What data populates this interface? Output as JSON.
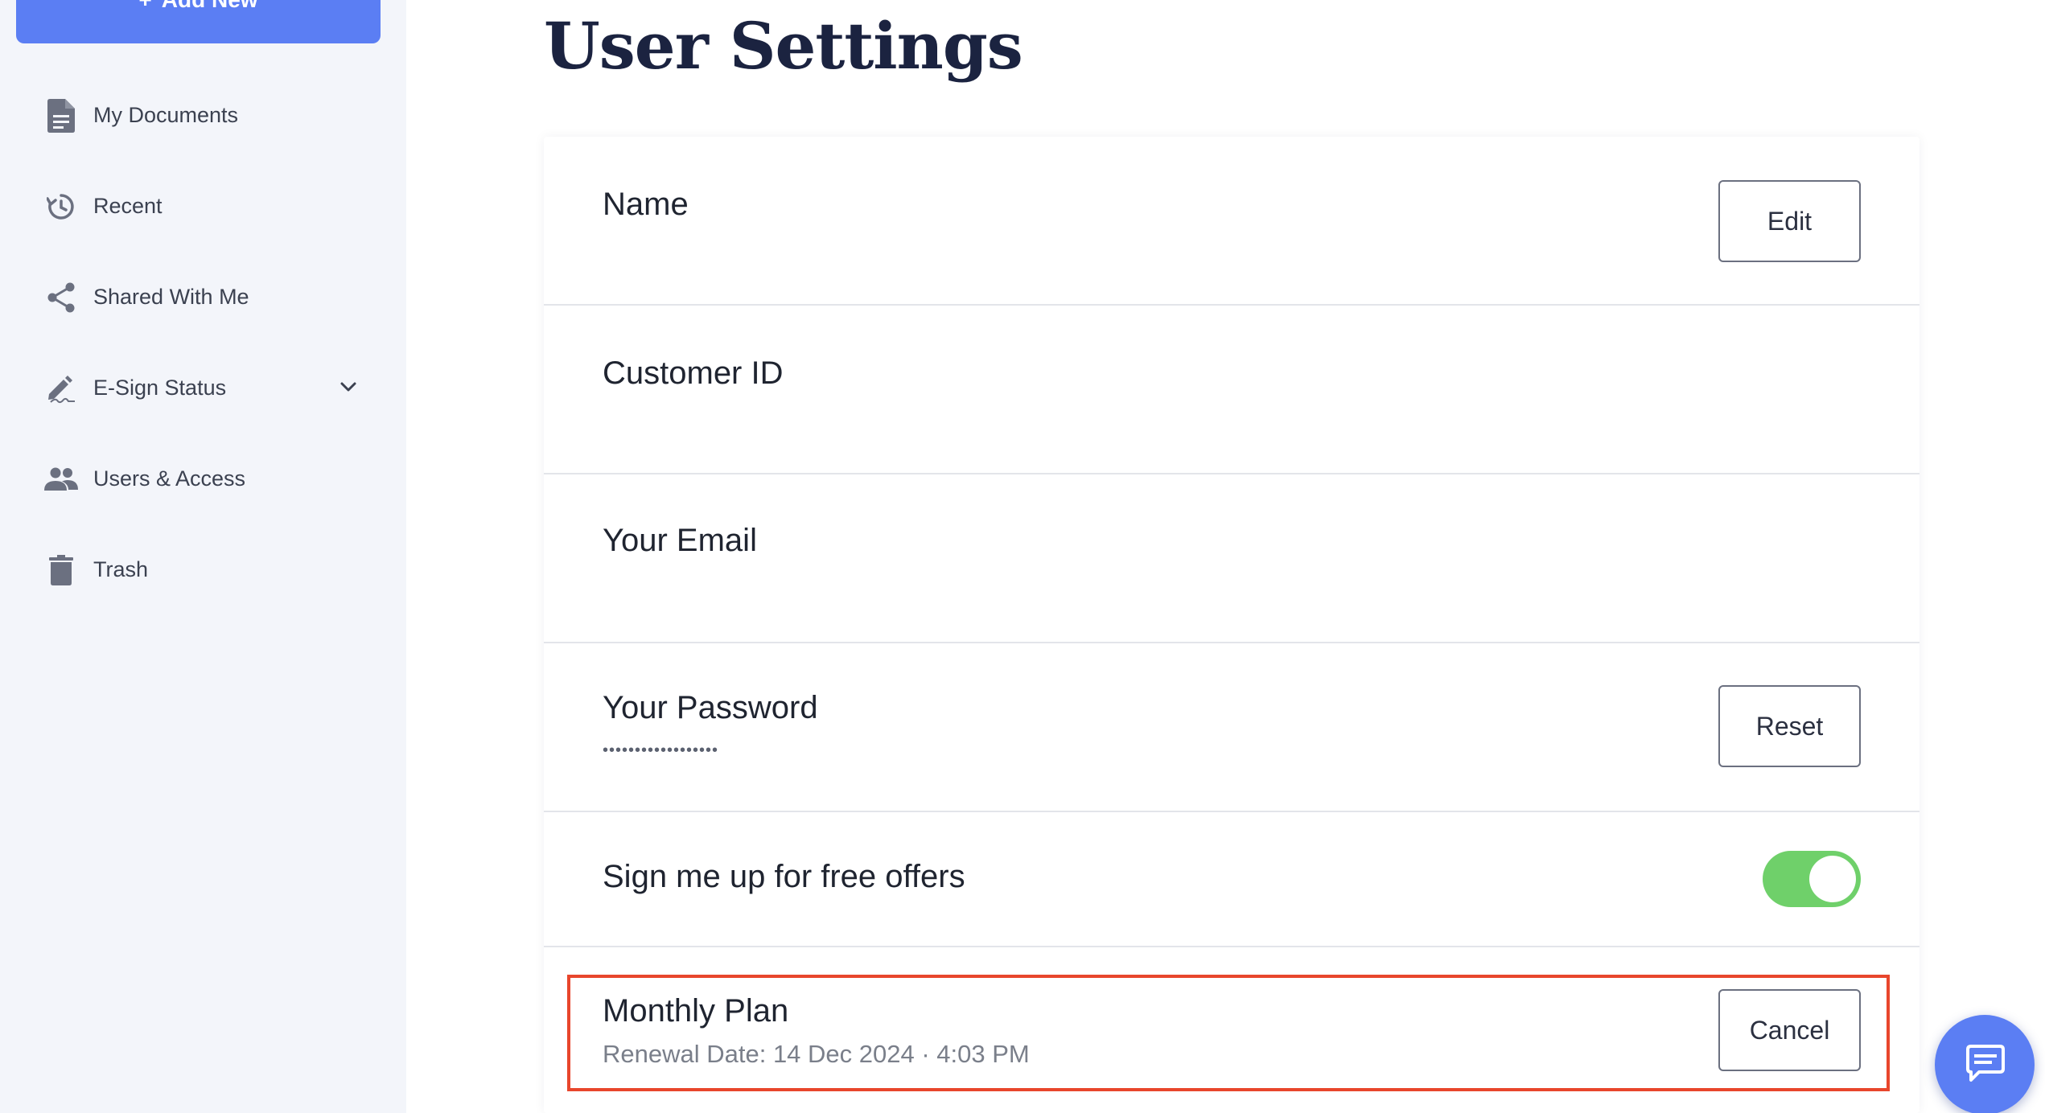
{
  "sidebar": {
    "add_new_label": "Add New",
    "items": [
      {
        "label": "My Documents",
        "icon": "document-icon"
      },
      {
        "label": "Recent",
        "icon": "history-icon"
      },
      {
        "label": "Shared With Me",
        "icon": "share-icon"
      },
      {
        "label": "E-Sign Status",
        "icon": "signature-pen-icon",
        "expandable": true
      },
      {
        "label": "Users & Access",
        "icon": "users-icon"
      },
      {
        "label": "Trash",
        "icon": "trash-icon"
      }
    ]
  },
  "main": {
    "title": "User Settings",
    "rows": {
      "name": {
        "label": "Name",
        "button": "Edit"
      },
      "customer_id": {
        "label": "Customer ID"
      },
      "email": {
        "label": "Your Email"
      },
      "password": {
        "label": "Your Password",
        "masked": "••••••••••••••••••",
        "button": "Reset"
      },
      "offers": {
        "label": "Sign me up for free offers",
        "enabled": true
      },
      "plan": {
        "label": "Monthly Plan",
        "renewal": "Renewal Date: 14 Dec 2024 · 4:03 PM",
        "button": "Cancel"
      }
    }
  },
  "colors": {
    "accent": "#5b7ef3",
    "toggle_on": "#6fd06a",
    "highlight": "#e8462c",
    "sidebar_bg": "#f3f5fa",
    "title": "#1b2340"
  },
  "chat": {
    "icon": "chat-icon"
  }
}
